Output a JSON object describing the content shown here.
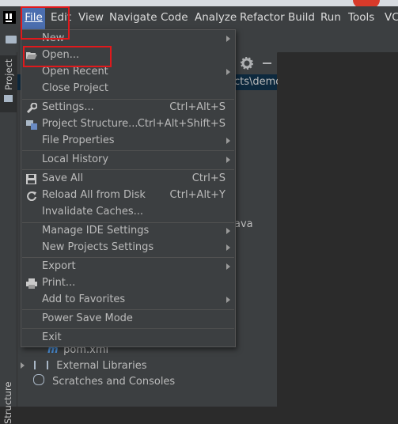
{
  "menubar": {
    "items": [
      "File",
      "Edit",
      "View",
      "Navigate",
      "Code",
      "Analyze",
      "Refactor",
      "Build",
      "Run",
      "Tools",
      "VCS"
    ]
  },
  "file_menu": {
    "items": {
      "new": {
        "label": "New"
      },
      "open": {
        "label": "Open..."
      },
      "open_recent": {
        "label": "Open Recent"
      },
      "close_project": {
        "label": "Close Project"
      },
      "settings": {
        "label": "Settings...",
        "shortcut": "Ctrl+Alt+S"
      },
      "project_structure": {
        "label": "Project Structure...",
        "shortcut": "Ctrl+Alt+Shift+S"
      },
      "file_properties": {
        "label": "File Properties"
      },
      "local_history": {
        "label": "Local History"
      },
      "save_all": {
        "label": "Save All",
        "shortcut": "Ctrl+S"
      },
      "reload_all": {
        "label": "Reload All from Disk",
        "shortcut": "Ctrl+Alt+Y"
      },
      "invalidate_caches": {
        "label": "Invalidate Caches..."
      },
      "manage_ide_settings": {
        "label": "Manage IDE Settings"
      },
      "new_projects_settings": {
        "label": "New Projects Settings"
      },
      "export": {
        "label": "Export"
      },
      "print": {
        "label": "Print..."
      },
      "add_to_favorites": {
        "label": "Add to Favorites"
      },
      "power_save_mode": {
        "label": "Power Save Mode"
      },
      "exit": {
        "label": "Exit"
      }
    }
  },
  "sidebar": {
    "project_tab": "Project",
    "structure_tab": "Structure"
  },
  "project_panel": {
    "path_fragment": "cts\\demo",
    "java_fragment": "ava",
    "tree": {
      "pom": "pom.xml",
      "external_libraries": "External Libraries",
      "scratches": "Scratches and Consoles"
    }
  },
  "colors": {
    "menubar_bg": "#3c3f41",
    "selected_menu": "#4b6eaf",
    "highlight_box": "#e0191c",
    "editor_bg": "#2b2b2b"
  }
}
